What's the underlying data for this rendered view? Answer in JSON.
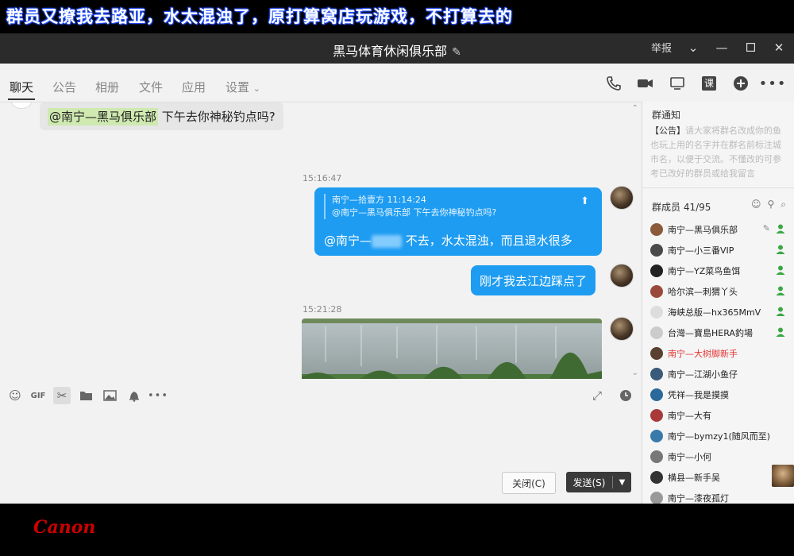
{
  "caption": "群员又撩我去路亚，水太混浊了，原打算窝店玩游戏，不打算去的",
  "window": {
    "title": "黑马体育休闲俱乐部",
    "report_label": "举报"
  },
  "tabs": [
    {
      "label": "聊天"
    },
    {
      "label": "公告"
    },
    {
      "label": "相册"
    },
    {
      "label": "文件"
    },
    {
      "label": "应用"
    },
    {
      "label": "设置"
    }
  ],
  "messages": {
    "m1_mention": "@南宁—黑马俱乐部",
    "m1_text": " 下午去你神秘钓点吗?",
    "time1": "15:16:47",
    "quote_header": "南宁—拾壹方    11:14:24",
    "quote_text": "@南宁—黑马俱乐部 下午去你神秘钓点吗?",
    "reply_mention": "@南宁—",
    "reply_text": " 不去，水太混浊，而且退水很多",
    "m3_text": "刚才我去江边踩点了",
    "time2": "15:21:28"
  },
  "buttons": {
    "close": "关闭(C)",
    "send": "发送(S)"
  },
  "notice": {
    "title": "群通知",
    "tag": "【公告】",
    "body": "请大家将群名改成你的鱼也玩上用的名字并在群名前标注城市名，以便于交流。不懂改的可参考已改好的群员或给我留言"
  },
  "members": {
    "header": "群成员 41/95",
    "list": [
      {
        "name": "南宁—黑马俱乐部",
        "color": "#222222"
      },
      {
        "name": "南宁—小三番VIP",
        "color": "#222222"
      },
      {
        "name": "南宁—YZ菜鸟鱼饵",
        "color": "#222222"
      },
      {
        "name": "哈尔滨—刺猬丫头",
        "color": "#222222"
      },
      {
        "name": "海峡总版—hx365MmV",
        "color": "#222222"
      },
      {
        "name": "台灣—寶島HERA釣場",
        "color": "#222222"
      },
      {
        "name": "南宁—大树脚新手",
        "color": "#e53232"
      },
      {
        "name": "南宁—江湖小鱼仔",
        "color": "#222222"
      },
      {
        "name": "凭祥—我是摸摸",
        "color": "#222222"
      },
      {
        "name": "南宁—大有",
        "color": "#222222"
      },
      {
        "name": "南宁—bymzy1(随风而至)",
        "color": "#222222"
      },
      {
        "name": "南宁—小何",
        "color": "#222222"
      },
      {
        "name": "横县—新手吴",
        "color": "#222222"
      },
      {
        "name": "南宁—漆夜孤灯",
        "color": "#222222"
      }
    ]
  },
  "brand": {
    "logo_text": "Canon",
    "logo_color": "#cc0000"
  },
  "colors": {
    "bubble_blue": "#1e9cf1",
    "titlebar": "#2b2b2b"
  }
}
